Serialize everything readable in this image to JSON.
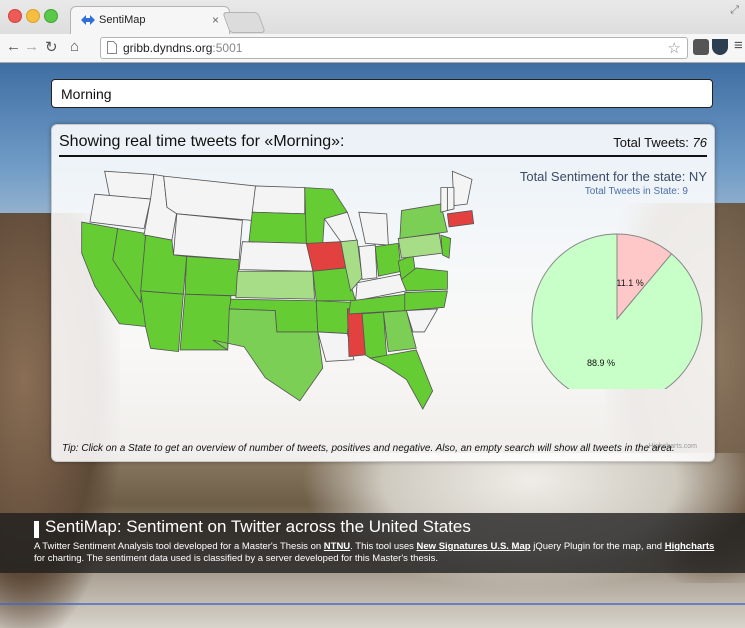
{
  "browser": {
    "tab_title": "SentiMap",
    "tab_close": "×",
    "url_host": "gribb.dyndns.org",
    "url_port": ":5001"
  },
  "search": {
    "value": "Morning"
  },
  "panel": {
    "heading": "Showing real time tweets for «Morning»:",
    "total_label": "Total Tweets: ",
    "total_value": "76"
  },
  "chart_data": {
    "type": "pie",
    "title": "Total Sentiment for the state: NY",
    "subtitle": "Total Tweets in State: 9",
    "slices": [
      {
        "label": "11.1 %",
        "value": 11.1,
        "color": "#ffc8c8"
      },
      {
        "label": "88.9 %",
        "value": 88.9,
        "color": "#c8ffc8"
      }
    ],
    "credit": "Highcharts.com"
  },
  "map": {
    "legend_colors": {
      "white": "#f4f4f4",
      "green": "#66cc33",
      "light_green": "#a8dd88",
      "mid_green": "#7ccf55",
      "red": "#e34040"
    },
    "states": [
      {
        "id": "WA",
        "color": "#f4f4f4"
      },
      {
        "id": "OR",
        "color": "#f4f4f4"
      },
      {
        "id": "CA",
        "color": "#66cc33"
      },
      {
        "id": "NV",
        "color": "#66cc33"
      },
      {
        "id": "ID",
        "color": "#f4f4f4"
      },
      {
        "id": "MT",
        "color": "#f4f4f4"
      },
      {
        "id": "WY",
        "color": "#f4f4f4"
      },
      {
        "id": "UT",
        "color": "#66cc33"
      },
      {
        "id": "AZ",
        "color": "#66cc33"
      },
      {
        "id": "CO",
        "color": "#66cc33"
      },
      {
        "id": "NM",
        "color": "#66cc33"
      },
      {
        "id": "ND",
        "color": "#f4f4f4"
      },
      {
        "id": "SD",
        "color": "#66cc33"
      },
      {
        "id": "NE",
        "color": "#f4f4f4"
      },
      {
        "id": "KS",
        "color": "#a8dd88"
      },
      {
        "id": "OK",
        "color": "#66cc33"
      },
      {
        "id": "TX",
        "color": "#7ccf55"
      },
      {
        "id": "MN",
        "color": "#66cc33"
      },
      {
        "id": "IA",
        "color": "#e34040"
      },
      {
        "id": "MO",
        "color": "#66cc33"
      },
      {
        "id": "AR",
        "color": "#66cc33"
      },
      {
        "id": "LA",
        "color": "#f4f4f4"
      },
      {
        "id": "WI",
        "color": "#f4f4f4"
      },
      {
        "id": "IL",
        "color": "#a8dd88"
      },
      {
        "id": "MS",
        "color": "#e34040"
      },
      {
        "id": "MI",
        "color": "#f4f4f4"
      },
      {
        "id": "IN",
        "color": "#f4f4f4"
      },
      {
        "id": "KY",
        "color": "#f4f4f4"
      },
      {
        "id": "TN",
        "color": "#66cc33"
      },
      {
        "id": "AL",
        "color": "#66cc33"
      },
      {
        "id": "OH",
        "color": "#66cc33"
      },
      {
        "id": "GA",
        "color": "#7ccf55"
      },
      {
        "id": "FL",
        "color": "#66cc33"
      },
      {
        "id": "WV",
        "color": "#66cc33"
      },
      {
        "id": "VA",
        "color": "#66cc33"
      },
      {
        "id": "NC",
        "color": "#66cc33"
      },
      {
        "id": "SC",
        "color": "#f4f4f4"
      },
      {
        "id": "PA",
        "color": "#a8dd88"
      },
      {
        "id": "NY",
        "color": "#7ccf55"
      },
      {
        "id": "NJ",
        "color": "#66cc33"
      },
      {
        "id": "MA",
        "color": "#e34040"
      },
      {
        "id": "ME",
        "color": "#f4f4f4"
      },
      {
        "id": "VT",
        "color": "#f4f4f4"
      },
      {
        "id": "NH",
        "color": "#f4f4f4"
      }
    ]
  },
  "tip": "Tip: Click on a State to get an overview of number of tweets, positives and negative. Also, an empty search will show all tweets in the area.",
  "footer": {
    "title": "SentiMap: Sentiment on Twitter across the United States",
    "desc_1": "A Twitter Sentiment Analysis tool developed for a Master's Thesis on ",
    "link_ntnu": "NTNU",
    "desc_2": ". This tool uses ",
    "link_map": "New Signatures U.S. Map",
    "desc_3": " jQuery Plugin for the map, and ",
    "link_highcharts": "Highcharts",
    "desc_4": " for charting. The sentiment data used is classified by a server developed for this Master's thesis."
  }
}
